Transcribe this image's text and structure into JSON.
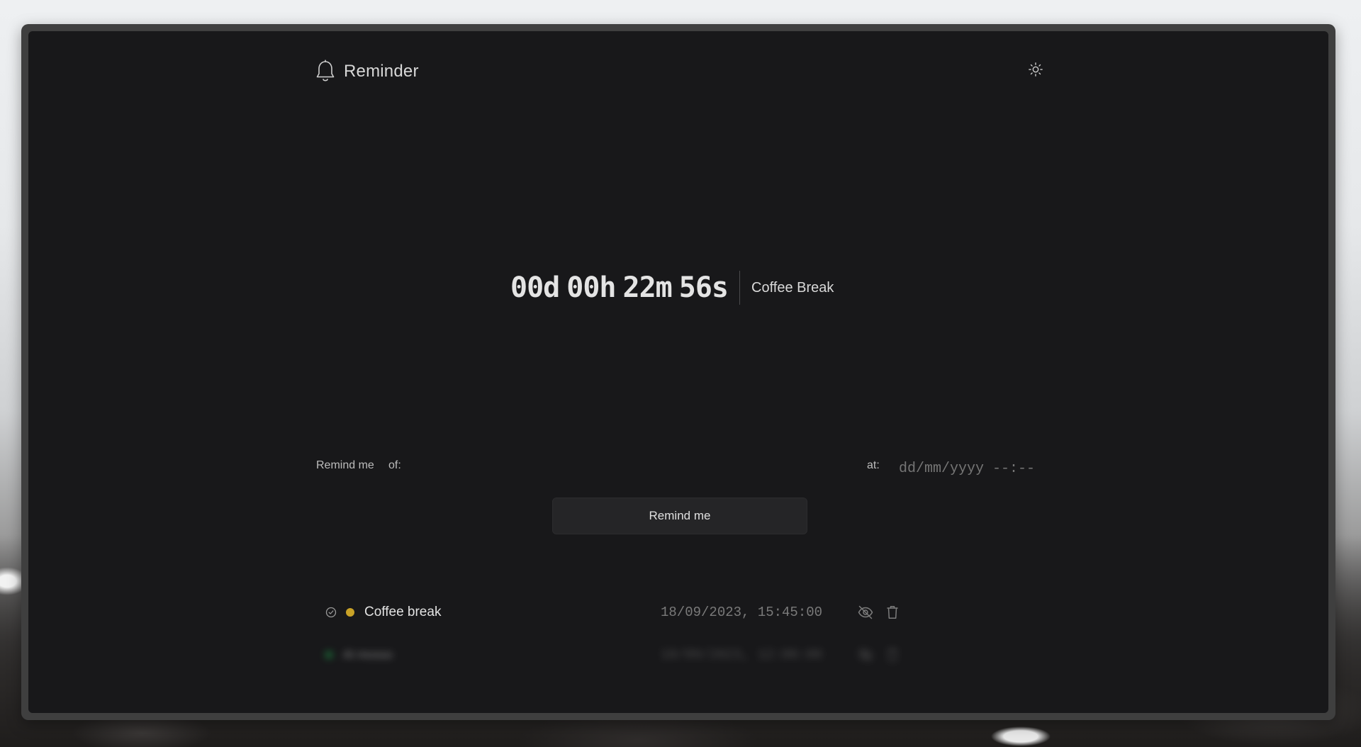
{
  "app": {
    "title": "Reminder"
  },
  "countdown": {
    "days": "00d",
    "hours": "00h",
    "minutes": "22m",
    "seconds": "56s",
    "label": "Coffee Break"
  },
  "form": {
    "remind_label": "Remind me",
    "of_label": "of:",
    "at_label": "at:",
    "name_value": "",
    "datetime_placeholder": "dd/mm/yyyy --:--",
    "submit_label": "Remind me"
  },
  "reminders": [
    {
      "title": "Coffee break",
      "datetime": "18/09/2023, 15:45:00",
      "status_color": "#c9a227",
      "has_check_icon": true,
      "hide_icon": "eye-off-icon",
      "delete_icon": "trash-icon"
    },
    {
      "title": "Al mosso",
      "datetime": "18/09/2023, 12:00:00",
      "status_color": "#1f9d4a",
      "has_check_icon": false,
      "hide_icon": "eye-off-icon",
      "delete_icon": "trash-icon"
    }
  ],
  "colors": {
    "background": "#18181a",
    "button_bg": "#252527",
    "text": "#e2e2e2",
    "muted": "#7a7a7a"
  }
}
